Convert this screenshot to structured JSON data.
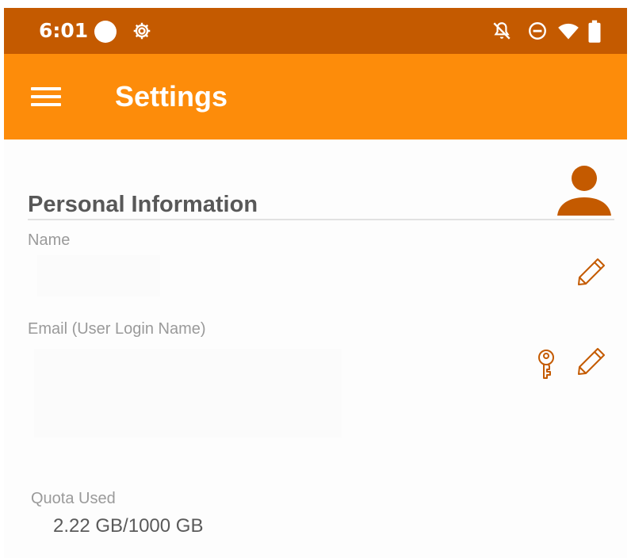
{
  "status_bar": {
    "time": "6:01",
    "icons": [
      "circle-indicator-icon",
      "gear-icon",
      "bell-off-icon",
      "do-not-disturb-icon",
      "wifi-icon",
      "battery-icon"
    ]
  },
  "app_bar": {
    "title": "Settings",
    "menu_icon": "hamburger-menu-icon"
  },
  "personal_info": {
    "heading": "Personal Information",
    "avatar_icon": "person-icon",
    "name": {
      "label": "Name",
      "value": ""
    },
    "email": {
      "label": "Email (User Login Name)",
      "value": ""
    },
    "quota": {
      "label": "Quota Used",
      "value": "2.22 GB/1000 GB"
    }
  },
  "colors": {
    "status_bar": "#c45a00",
    "app_bar": "#fd8c0a",
    "accent_icon": "#c45a00",
    "label_text": "#9a9a9a",
    "heading_text": "#585858"
  }
}
